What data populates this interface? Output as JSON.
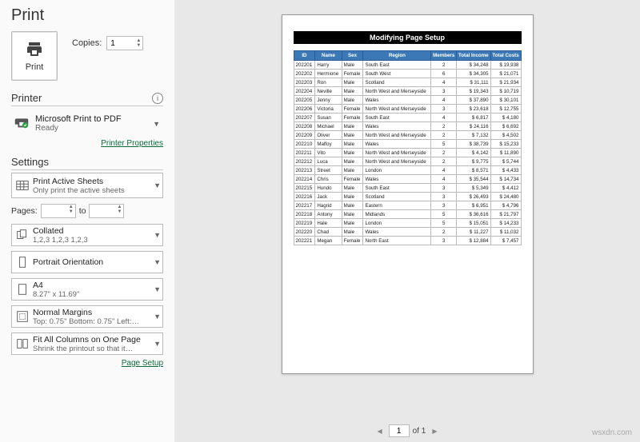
{
  "title": "Print",
  "printButton": "Print",
  "copiesLabel": "Copies:",
  "copiesValue": "1",
  "printerSection": "Printer",
  "printer": {
    "name": "Microsoft Print to PDF",
    "status": "Ready"
  },
  "printerPropsLink": "Printer Properties",
  "settingsSection": "Settings",
  "settings": {
    "what": {
      "l1": "Print Active Sheets",
      "l2": "Only print the active sheets"
    },
    "pagesLabel": "Pages:",
    "to": "to",
    "collate": {
      "l1": "Collated",
      "l2": "1,2,3    1,2,3    1,2,3"
    },
    "orient": {
      "l1": "Portrait Orientation",
      "l2": ""
    },
    "paper": {
      "l1": "A4",
      "l2": "8.27\" x 11.69\""
    },
    "margins": {
      "l1": "Normal Margins",
      "l2": "Top: 0.75\" Bottom: 0.75\" Left:…"
    },
    "scale": {
      "l1": "Fit All Columns on One Page",
      "l2": "Shrink the printout so that it…"
    }
  },
  "pageSetupLink": "Page Setup",
  "nav": {
    "page": "1",
    "of": "of 1"
  },
  "watermark": "wsxdn.com",
  "preview": {
    "title": "Modifying Page Setup",
    "headers": [
      "ID",
      "Name",
      "Sex",
      "Region",
      "Members",
      "Total Income",
      "Total Costs"
    ],
    "rows": [
      [
        "202201",
        "Harry",
        "Male",
        "South East",
        "2",
        "$ 34,248",
        "$ 19,938"
      ],
      [
        "202202",
        "Hermione",
        "Female",
        "South West",
        "6",
        "$ 34,305",
        "$ 21,071"
      ],
      [
        "202203",
        "Ron",
        "Male",
        "Scotland",
        "4",
        "$ 31,111",
        "$ 21,934"
      ],
      [
        "202204",
        "Neville",
        "Male",
        "North West and Merseyside",
        "3",
        "$ 19,343",
        "$ 10,719"
      ],
      [
        "202205",
        "Jenny",
        "Male",
        "Wales",
        "4",
        "$ 37,890",
        "$ 30,101"
      ],
      [
        "202206",
        "Victoria",
        "Female",
        "North West and Merseyside",
        "3",
        "$ 23,618",
        "$ 12,755"
      ],
      [
        "202207",
        "Susan",
        "Female",
        "South East",
        "4",
        "$  6,817",
        "$  4,180"
      ],
      [
        "202208",
        "Michael",
        "Male",
        "Wales",
        "2",
        "$ 24,116",
        "$  6,692"
      ],
      [
        "202209",
        "Oliver",
        "Male",
        "North West and Merseyside",
        "2",
        "$  7,132",
        "$  4,502"
      ],
      [
        "202210",
        "Malfoy",
        "Male",
        "Wales",
        "5",
        "$ 38,739",
        "$ 15,233"
      ],
      [
        "202211",
        "Vito",
        "Male",
        "North West and Merseyside",
        "2",
        "$  4,142",
        "$ 11,890"
      ],
      [
        "202212",
        "Luca",
        "Male",
        "North West and Merseyside",
        "2",
        "$  9,775",
        "$  5,744"
      ],
      [
        "202213",
        "Street",
        "Male",
        "London",
        "4",
        "$  8,571",
        "$  4,433"
      ],
      [
        "202214",
        "Chris",
        "Female",
        "Wales",
        "4",
        "$ 35,544",
        "$ 14,734"
      ],
      [
        "202215",
        "Hundo",
        "Male",
        "South East",
        "3",
        "$  5,349",
        "$  4,412"
      ],
      [
        "202216",
        "Jack",
        "Male",
        "Scotland",
        "3",
        "$ 26,493",
        "$ 24,480"
      ],
      [
        "202217",
        "Hagrid",
        "Male",
        "Eastern",
        "3",
        "$  6,951",
        "$  4,796"
      ],
      [
        "202218",
        "Antony",
        "Male",
        "Midlands",
        "5",
        "$ 36,616",
        "$ 21,797"
      ],
      [
        "202219",
        "Hale",
        "Male",
        "London",
        "5",
        "$ 15,051",
        "$ 14,233"
      ],
      [
        "202220",
        "Chad",
        "Male",
        "Wales",
        "2",
        "$ 11,227",
        "$ 11,032"
      ],
      [
        "202221",
        "Megan",
        "Female",
        "North East",
        "3",
        "$ 12,884",
        "$  7,457"
      ]
    ]
  }
}
